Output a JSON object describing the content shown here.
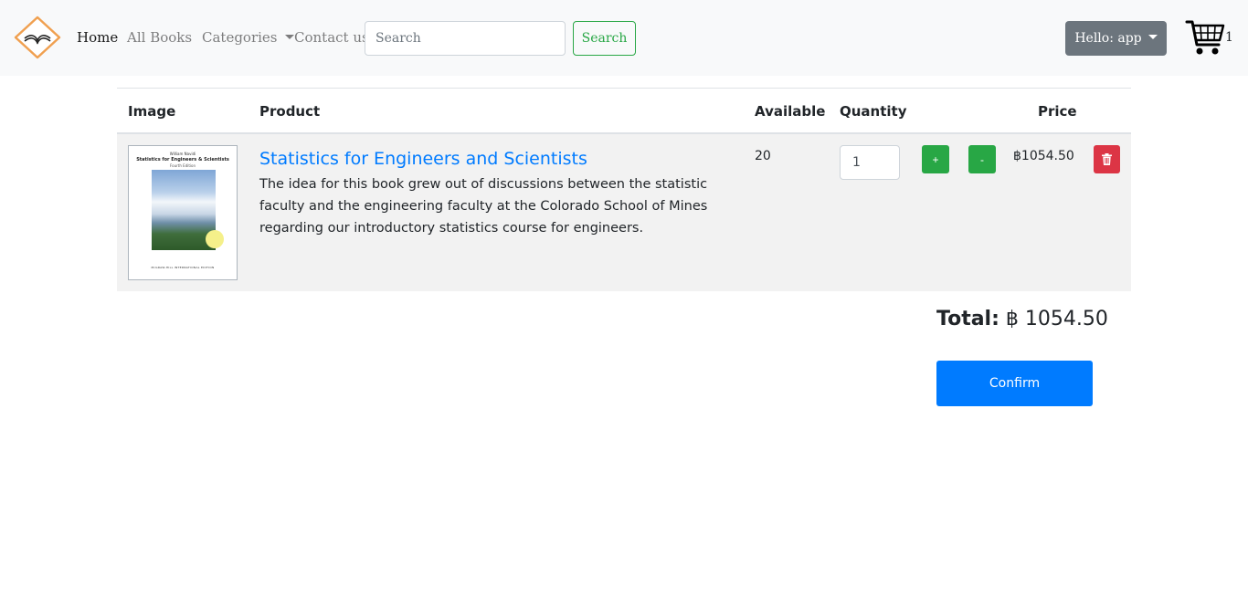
{
  "nav": {
    "home": "Home",
    "all_books": "All Books",
    "categories": "Categories",
    "contact": "Contact us",
    "search_placeholder": "Search",
    "search_button": "Search",
    "user_menu": "Hello: app",
    "cart_count": "1"
  },
  "table": {
    "headers": {
      "image": "Image",
      "product": "Product",
      "available": "Available",
      "quantity": "Quantity",
      "price": "Price"
    },
    "rows": [
      {
        "cover": {
          "author": "William Navidi",
          "title": "Statistics for Engineers & Scientists",
          "edition": "Fourth Edition",
          "publisher": "McGRAW-HILL INTERNATIONAL EDITION"
        },
        "title": "Statistics for Engineers and Scientists",
        "description": "The idea for this book grew out of discussions between the statistic faculty and the engineering faculty at the Colorado School of Mines regarding our introductory statistics course for engineers.",
        "available": "20",
        "quantity": "1",
        "plus": "+",
        "minus": "-",
        "price": "฿1054.50"
      }
    ]
  },
  "summary": {
    "total_label": "Total:",
    "total_value": "฿ 1054.50",
    "confirm": "Confirm"
  },
  "colors": {
    "primary": "#007bff",
    "success": "#28a745",
    "danger": "#dc3545",
    "secondary": "#6c757d",
    "navbar": "#f8f9fa",
    "row": "#f2f2f2"
  },
  "icons": {
    "logo": "book-diamond-logo",
    "cart": "shopping-cart-icon",
    "delete": "trash-icon"
  }
}
